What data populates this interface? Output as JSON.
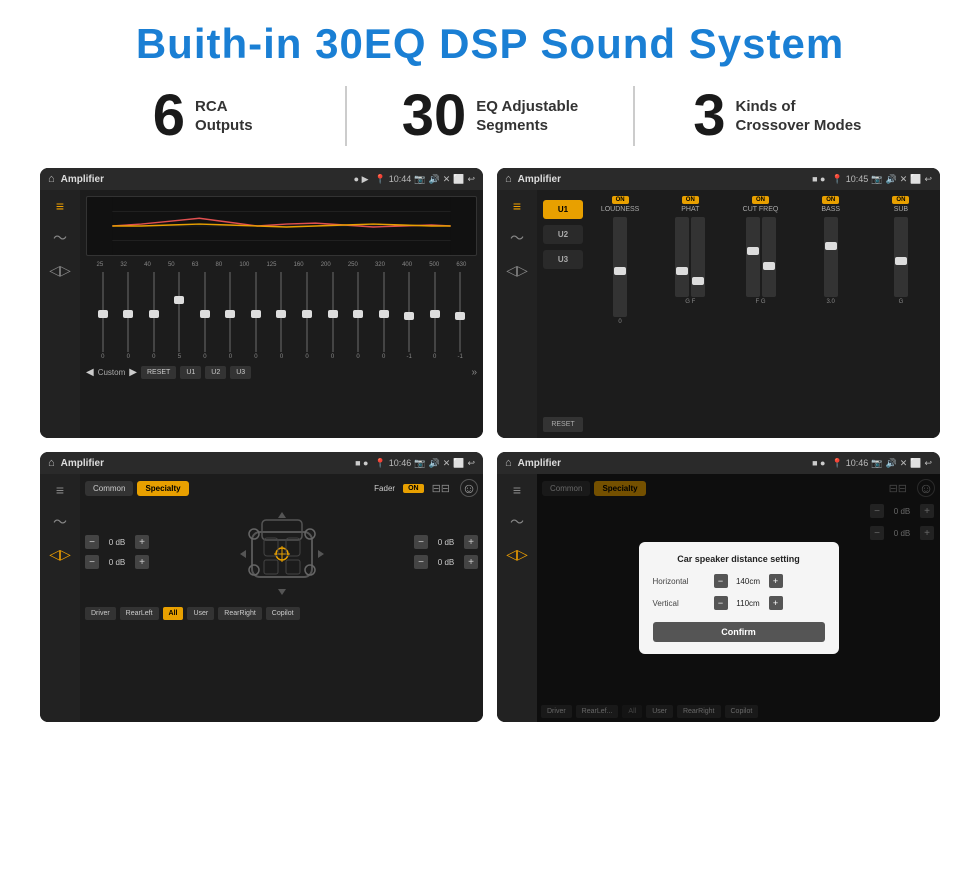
{
  "page": {
    "title": "Buith-in 30EQ DSP Sound System",
    "stats": [
      {
        "number": "6",
        "line1": "RCA",
        "line2": "Outputs"
      },
      {
        "number": "30",
        "line1": "EQ Adjustable",
        "line2": "Segments"
      },
      {
        "number": "3",
        "line1": "Kinds of",
        "line2": "Crossover Modes"
      }
    ]
  },
  "screens": [
    {
      "id": "screen1",
      "app": "Amplifier",
      "time": "10:44",
      "type": "eq"
    },
    {
      "id": "screen2",
      "app": "Amplifier",
      "time": "10:45",
      "type": "amp"
    },
    {
      "id": "screen3",
      "app": "Amplifier",
      "time": "10:46",
      "type": "fader"
    },
    {
      "id": "screen4",
      "app": "Amplifier",
      "time": "10:46",
      "type": "fader-dialog"
    }
  ],
  "eq": {
    "freqs": [
      "25",
      "32",
      "40",
      "50",
      "63",
      "80",
      "100",
      "125",
      "160",
      "200",
      "250",
      "320",
      "400",
      "500",
      "630"
    ],
    "values": [
      "0",
      "0",
      "0",
      "5",
      "0",
      "0",
      "0",
      "0",
      "0",
      "0",
      "0",
      "0",
      "-1",
      "0",
      "-1"
    ],
    "presets": [
      "Custom",
      "RESET",
      "U1",
      "U2",
      "U3"
    ]
  },
  "amp": {
    "presets": [
      "U1",
      "U2",
      "U3"
    ],
    "channels": [
      {
        "name": "LOUDNESS",
        "on": true
      },
      {
        "name": "PHAT",
        "on": true
      },
      {
        "name": "CUT FREQ",
        "on": true
      },
      {
        "name": "BASS",
        "on": true
      },
      {
        "name": "SUB",
        "on": true
      }
    ],
    "resetLabel": "RESET"
  },
  "fader": {
    "tabs": [
      "Common",
      "Specialty"
    ],
    "activeTab": "Specialty",
    "faderLabel": "Fader",
    "faderOn": "ON",
    "channels": [
      {
        "label": "0 dB",
        "side": "left"
      },
      {
        "label": "0 dB",
        "side": "left"
      },
      {
        "label": "0 dB",
        "side": "right"
      },
      {
        "label": "0 dB",
        "side": "right"
      }
    ],
    "bottomBtns": [
      "Driver",
      "RearLeft",
      "All",
      "User",
      "RearRight",
      "Copilot"
    ]
  },
  "dialog": {
    "title": "Car speaker distance setting",
    "horizontal": {
      "label": "Horizontal",
      "value": "140cm"
    },
    "vertical": {
      "label": "Vertical",
      "value": "110cm"
    },
    "confirm": "Confirm"
  }
}
